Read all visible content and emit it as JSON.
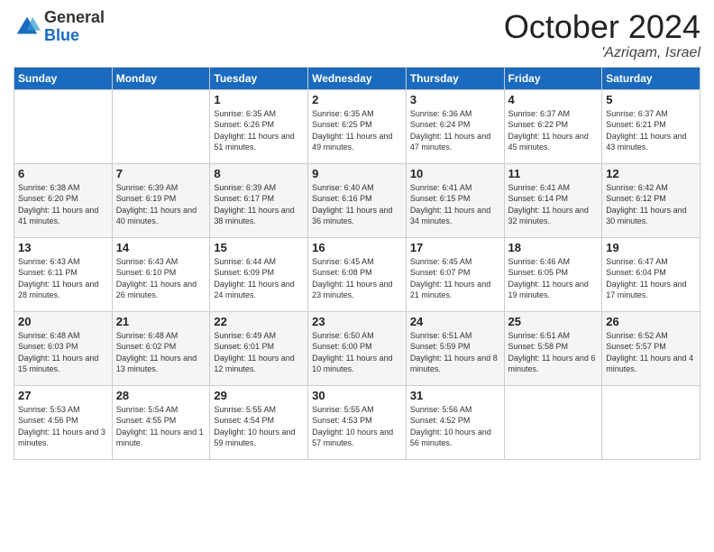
{
  "logo": {
    "general": "General",
    "blue": "Blue"
  },
  "header": {
    "month": "October 2024",
    "location": "'Azriqam, Israel"
  },
  "weekdays": [
    "Sunday",
    "Monday",
    "Tuesday",
    "Wednesday",
    "Thursday",
    "Friday",
    "Saturday"
  ],
  "weeks": [
    [
      {
        "day": "",
        "sunrise": "",
        "sunset": "",
        "daylight": ""
      },
      {
        "day": "",
        "sunrise": "",
        "sunset": "",
        "daylight": ""
      },
      {
        "day": "1",
        "sunrise": "Sunrise: 6:35 AM",
        "sunset": "Sunset: 6:26 PM",
        "daylight": "Daylight: 11 hours and 51 minutes."
      },
      {
        "day": "2",
        "sunrise": "Sunrise: 6:35 AM",
        "sunset": "Sunset: 6:25 PM",
        "daylight": "Daylight: 11 hours and 49 minutes."
      },
      {
        "day": "3",
        "sunrise": "Sunrise: 6:36 AM",
        "sunset": "Sunset: 6:24 PM",
        "daylight": "Daylight: 11 hours and 47 minutes."
      },
      {
        "day": "4",
        "sunrise": "Sunrise: 6:37 AM",
        "sunset": "Sunset: 6:22 PM",
        "daylight": "Daylight: 11 hours and 45 minutes."
      },
      {
        "day": "5",
        "sunrise": "Sunrise: 6:37 AM",
        "sunset": "Sunset: 6:21 PM",
        "daylight": "Daylight: 11 hours and 43 minutes."
      }
    ],
    [
      {
        "day": "6",
        "sunrise": "Sunrise: 6:38 AM",
        "sunset": "Sunset: 6:20 PM",
        "daylight": "Daylight: 11 hours and 41 minutes."
      },
      {
        "day": "7",
        "sunrise": "Sunrise: 6:39 AM",
        "sunset": "Sunset: 6:19 PM",
        "daylight": "Daylight: 11 hours and 40 minutes."
      },
      {
        "day": "8",
        "sunrise": "Sunrise: 6:39 AM",
        "sunset": "Sunset: 6:17 PM",
        "daylight": "Daylight: 11 hours and 38 minutes."
      },
      {
        "day": "9",
        "sunrise": "Sunrise: 6:40 AM",
        "sunset": "Sunset: 6:16 PM",
        "daylight": "Daylight: 11 hours and 36 minutes."
      },
      {
        "day": "10",
        "sunrise": "Sunrise: 6:41 AM",
        "sunset": "Sunset: 6:15 PM",
        "daylight": "Daylight: 11 hours and 34 minutes."
      },
      {
        "day": "11",
        "sunrise": "Sunrise: 6:41 AM",
        "sunset": "Sunset: 6:14 PM",
        "daylight": "Daylight: 11 hours and 32 minutes."
      },
      {
        "day": "12",
        "sunrise": "Sunrise: 6:42 AM",
        "sunset": "Sunset: 6:12 PM",
        "daylight": "Daylight: 11 hours and 30 minutes."
      }
    ],
    [
      {
        "day": "13",
        "sunrise": "Sunrise: 6:43 AM",
        "sunset": "Sunset: 6:11 PM",
        "daylight": "Daylight: 11 hours and 28 minutes."
      },
      {
        "day": "14",
        "sunrise": "Sunrise: 6:43 AM",
        "sunset": "Sunset: 6:10 PM",
        "daylight": "Daylight: 11 hours and 26 minutes."
      },
      {
        "day": "15",
        "sunrise": "Sunrise: 6:44 AM",
        "sunset": "Sunset: 6:09 PM",
        "daylight": "Daylight: 11 hours and 24 minutes."
      },
      {
        "day": "16",
        "sunrise": "Sunrise: 6:45 AM",
        "sunset": "Sunset: 6:08 PM",
        "daylight": "Daylight: 11 hours and 23 minutes."
      },
      {
        "day": "17",
        "sunrise": "Sunrise: 6:45 AM",
        "sunset": "Sunset: 6:07 PM",
        "daylight": "Daylight: 11 hours and 21 minutes."
      },
      {
        "day": "18",
        "sunrise": "Sunrise: 6:46 AM",
        "sunset": "Sunset: 6:05 PM",
        "daylight": "Daylight: 11 hours and 19 minutes."
      },
      {
        "day": "19",
        "sunrise": "Sunrise: 6:47 AM",
        "sunset": "Sunset: 6:04 PM",
        "daylight": "Daylight: 11 hours and 17 minutes."
      }
    ],
    [
      {
        "day": "20",
        "sunrise": "Sunrise: 6:48 AM",
        "sunset": "Sunset: 6:03 PM",
        "daylight": "Daylight: 11 hours and 15 minutes."
      },
      {
        "day": "21",
        "sunrise": "Sunrise: 6:48 AM",
        "sunset": "Sunset: 6:02 PM",
        "daylight": "Daylight: 11 hours and 13 minutes."
      },
      {
        "day": "22",
        "sunrise": "Sunrise: 6:49 AM",
        "sunset": "Sunset: 6:01 PM",
        "daylight": "Daylight: 11 hours and 12 minutes."
      },
      {
        "day": "23",
        "sunrise": "Sunrise: 6:50 AM",
        "sunset": "Sunset: 6:00 PM",
        "daylight": "Daylight: 11 hours and 10 minutes."
      },
      {
        "day": "24",
        "sunrise": "Sunrise: 6:51 AM",
        "sunset": "Sunset: 5:59 PM",
        "daylight": "Daylight: 11 hours and 8 minutes."
      },
      {
        "day": "25",
        "sunrise": "Sunrise: 6:51 AM",
        "sunset": "Sunset: 5:58 PM",
        "daylight": "Daylight: 11 hours and 6 minutes."
      },
      {
        "day": "26",
        "sunrise": "Sunrise: 6:52 AM",
        "sunset": "Sunset: 5:57 PM",
        "daylight": "Daylight: 11 hours and 4 minutes."
      }
    ],
    [
      {
        "day": "27",
        "sunrise": "Sunrise: 5:53 AM",
        "sunset": "Sunset: 4:56 PM",
        "daylight": "Daylight: 11 hours and 3 minutes."
      },
      {
        "day": "28",
        "sunrise": "Sunrise: 5:54 AM",
        "sunset": "Sunset: 4:55 PM",
        "daylight": "Daylight: 11 hours and 1 minute."
      },
      {
        "day": "29",
        "sunrise": "Sunrise: 5:55 AM",
        "sunset": "Sunset: 4:54 PM",
        "daylight": "Daylight: 10 hours and 59 minutes."
      },
      {
        "day": "30",
        "sunrise": "Sunrise: 5:55 AM",
        "sunset": "Sunset: 4:53 PM",
        "daylight": "Daylight: 10 hours and 57 minutes."
      },
      {
        "day": "31",
        "sunrise": "Sunrise: 5:56 AM",
        "sunset": "Sunset: 4:52 PM",
        "daylight": "Daylight: 10 hours and 56 minutes."
      },
      {
        "day": "",
        "sunrise": "",
        "sunset": "",
        "daylight": ""
      },
      {
        "day": "",
        "sunrise": "",
        "sunset": "",
        "daylight": ""
      }
    ]
  ]
}
